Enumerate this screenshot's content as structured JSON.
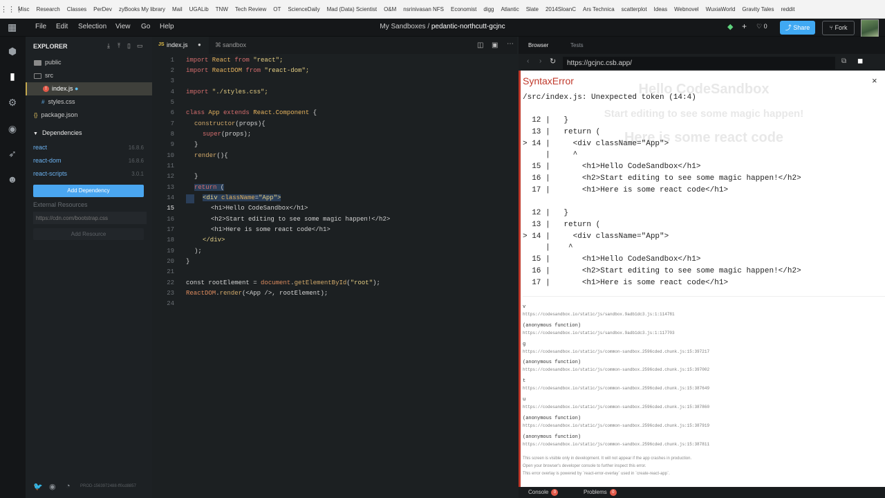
{
  "bookmarks": [
    "Misc",
    "Research",
    "Classes",
    "PerDev",
    "zyBooks My library",
    "Mail",
    "UGALib",
    "TNW",
    "Tech Review",
    "OT",
    "ScienceDaily",
    "Mad (Data) Scientist",
    "O&M",
    "nsrinivasan NFS",
    "Economist",
    "digg",
    "Atlantic",
    "Slate",
    "2014SloanC",
    "Ars Technica",
    "scatterplot",
    "Ideas",
    "Webnovel",
    "WuxiaWorld",
    "Gravity Tales",
    "reddit"
  ],
  "menu": {
    "file": "File",
    "edit": "Edit",
    "selection": "Selection",
    "view": "View",
    "go": "Go",
    "help": "Help"
  },
  "header": {
    "sandbox_group": "My Sandboxes",
    "sep": "/",
    "sandbox_name": "pedantic-northcutt-gcjnc",
    "like_count": "0",
    "share": "Share",
    "fork": "Fork"
  },
  "explorer": {
    "title": "EXPLORER",
    "files": {
      "public": "public",
      "src": "src",
      "index": "index.js",
      "styles": "styles.css",
      "package": "package.json"
    },
    "dependencies_title": "Dependencies",
    "dependencies": [
      {
        "name": "react",
        "version": "16.8.6"
      },
      {
        "name": "react-dom",
        "version": "16.8.6"
      },
      {
        "name": "react-scripts",
        "version": "3.0.1"
      }
    ],
    "add_dependency": "Add Dependency",
    "external_resources": "External Resources",
    "cdn_placeholder": "https://cdn.com/bootstrap.css",
    "add_resource": "Add Resource",
    "build_id": "PROD-1563972488-ff0cd8857"
  },
  "editor": {
    "tabs": {
      "active": "index.js",
      "other": "sandbox",
      "js_badge": "JS"
    },
    "line_numbers": [
      "1",
      "2",
      "3",
      "4",
      "5",
      "6",
      "7",
      "8",
      "9",
      "10",
      "11",
      "12",
      "13",
      "14",
      "15",
      "16",
      "17",
      "18",
      "19",
      "20",
      "21",
      "22",
      "23",
      "24"
    ],
    "lines": {
      "l1": {
        "kw1": "import",
        "name": " React ",
        "kw2": "from",
        "str": " \"react\";"
      },
      "l2": {
        "kw1": "import",
        "name": " ReactDOM ",
        "kw2": "from",
        "str": " \"react-dom\";"
      },
      "l4": {
        "kw1": "import",
        "str": " \"./styles.css\";"
      },
      "l6": {
        "kw1": "class",
        "name": " App ",
        "kw2": "extends",
        "cls": " React.Component",
        "rest": " {"
      },
      "l7": {
        "fn": "constructor",
        "rest": "(props){"
      },
      "l8": {
        "kw": "super",
        "rest": "(props);"
      },
      "l9": "}",
      "l10": {
        "fn": "render",
        "rest": "(){"
      },
      "l12": "}",
      "l13": {
        "kw": "return",
        "rest": " ("
      },
      "l14": {
        "tag": "<div ",
        "attr": "className",
        "rest": "=",
        "str": "\"App\"",
        "tag2": ">"
      },
      "l15": "<h1>Hello CodeSandbox</h1>",
      "l16": "<h2>Start editing to see some magic happen!</h2>",
      "l17": "<h1>Here is some react code</h1>",
      "l18": "</div>",
      "l19": ");",
      "l20": "}",
      "l22": {
        "kw": "const",
        "rest1": " rootElement = ",
        "obj": "document",
        "rest2": ".",
        "fn": "getElementById",
        "rest3": "(",
        "str": "\"root\"",
        "rest4": ");"
      },
      "l23": {
        "obj": "ReactDOM",
        "rest1": ".",
        "fn": "render",
        "rest2": "(<App />, rootElement);"
      }
    }
  },
  "browser": {
    "tabs": {
      "browser": "Browser",
      "tests": "Tests"
    },
    "url": "https://gcjnc.csb.app/",
    "ghost": {
      "h1": "Hello CodeSandbox",
      "h2": "Start editing to see some magic happen!",
      "h1b": "Here is some react code"
    },
    "error": {
      "title": "SyntaxError",
      "message": "/src/index.js: Unexpected token (14:4)",
      "frame": [
        "  12 |   }",
        "  13 |   return (",
        "> 14 |     <div className=\"App\">",
        "     |     ^",
        "  15 |       <h1>Hello CodeSandbox</h1>",
        "  16 |       <h2>Start editing to see some magic happen!</h2>",
        "  17 |       <h1>Here is some react code</h1>"
      ],
      "frame2": [
        "  12 |   }",
        "  13 |   return (",
        "> 14 |     <div className=\"App\">",
        "     |    ^",
        "  15 |       <h1>Hello CodeSandbox</h1>",
        "  16 |       <h2>Start editing to see some magic happen!</h2>",
        "  17 |       <h1>Here is some react code</h1>"
      ],
      "trace": [
        {
          "fn": "v",
          "url": "https://codesandbox.io/static/js/sandbox.9adb1dc3.js:1:114781"
        },
        {
          "fn": "(anonymous function)",
          "url": "https://codesandbox.io/static/js/sandbox.9adb1dc3.js:1:117703"
        },
        {
          "fn": "g",
          "url": "https://codesandbox.io/static/js/common-sandbox.2596cded.chunk.js:15:397217"
        },
        {
          "fn": "(anonymous function)",
          "url": "https://codesandbox.io/static/js/common-sandbox.2596cded.chunk.js:15:397002"
        },
        {
          "fn": "t",
          "url": "https://codesandbox.io/static/js/common-sandbox.2596cded.chunk.js:15:387649"
        },
        {
          "fn": "u",
          "url": "https://codesandbox.io/static/js/common-sandbox.2596cded.chunk.js:15:387860"
        },
        {
          "fn": "(anonymous function)",
          "url": "https://codesandbox.io/static/js/common-sandbox.2596cded.chunk.js:15:387919"
        },
        {
          "fn": "(anonymous function)",
          "url": "https://codesandbox.io/static/js/common-sandbox.2596cded.chunk.js:15:387811"
        }
      ],
      "footer": [
        "This screen is visible only in development. It will not appear if the app crashes in production.",
        "Open your browser's developer console to further inspect this error.",
        "This error overlay is powered by `react-error-overlay` used in `create-react-app`."
      ]
    },
    "bottom": {
      "console": "Console",
      "console_count": "0",
      "problems": "Problems",
      "problems_count": "0"
    }
  },
  "colors": {
    "accent": "#40a9f3",
    "error": "#c0392b",
    "bg": "#1c2022"
  }
}
